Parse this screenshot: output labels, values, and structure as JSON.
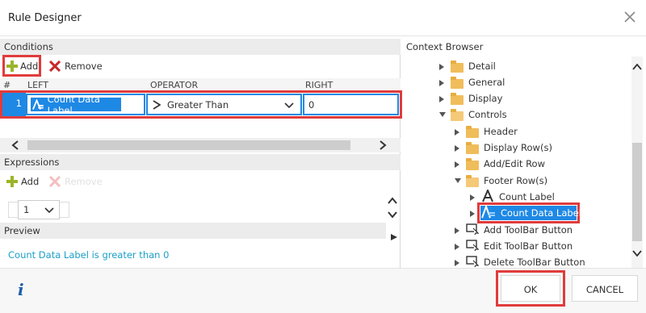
{
  "dialog": {
    "title": "Rule Designer"
  },
  "conditions": {
    "header": "Conditions",
    "add_label": "Add",
    "remove_label": "Remove",
    "columns": {
      "num": "#",
      "left": "LEFT",
      "operator": "OPERATOR",
      "right": "RIGHT"
    },
    "row": {
      "index": "1",
      "left": "Count Data Label",
      "operator": "Greater Than",
      "right": "0"
    }
  },
  "expressions": {
    "header": "Expressions",
    "add_label": "Add",
    "remove_label": "Remove",
    "page_value": "1"
  },
  "preview": {
    "header": "Preview",
    "text": "Count Data Label is greater than 0"
  },
  "context_browser": {
    "header": "Context Browser",
    "items": [
      {
        "label": "Detail",
        "icon": "folder-icon"
      },
      {
        "label": "General",
        "icon": "folder-icon"
      },
      {
        "label": "Display",
        "icon": "folder-icon"
      },
      {
        "label": "Controls",
        "icon": "folder-open-icon"
      },
      {
        "label": "Header",
        "icon": "folder-icon"
      },
      {
        "label": "Display Row(s)",
        "icon": "folder-icon"
      },
      {
        "label": "Add/Edit Row",
        "icon": "folder-icon"
      },
      {
        "label": "Footer Row(s)",
        "icon": "folder-open-icon"
      },
      {
        "label": "Count Label",
        "icon": "label-icon"
      },
      {
        "label": "Count Data Label",
        "icon": "data-label-icon"
      },
      {
        "label": "Add ToolBar Button",
        "icon": "button-control-icon"
      },
      {
        "label": "Edit ToolBar Button",
        "icon": "button-control-icon"
      },
      {
        "label": "Delete ToolBar Button",
        "icon": "button-control-icon"
      }
    ]
  },
  "footer": {
    "info_icon": "i",
    "ok_label": "OK",
    "cancel_label": "CANCEL"
  },
  "colors": {
    "accent": "#1e88e5",
    "highlight_border": "#e13b3b",
    "preview_text": "#1ba0c8",
    "add_icon": "#9ab52a",
    "remove_icon": "#c62828",
    "folder": "#f0bd5b"
  }
}
